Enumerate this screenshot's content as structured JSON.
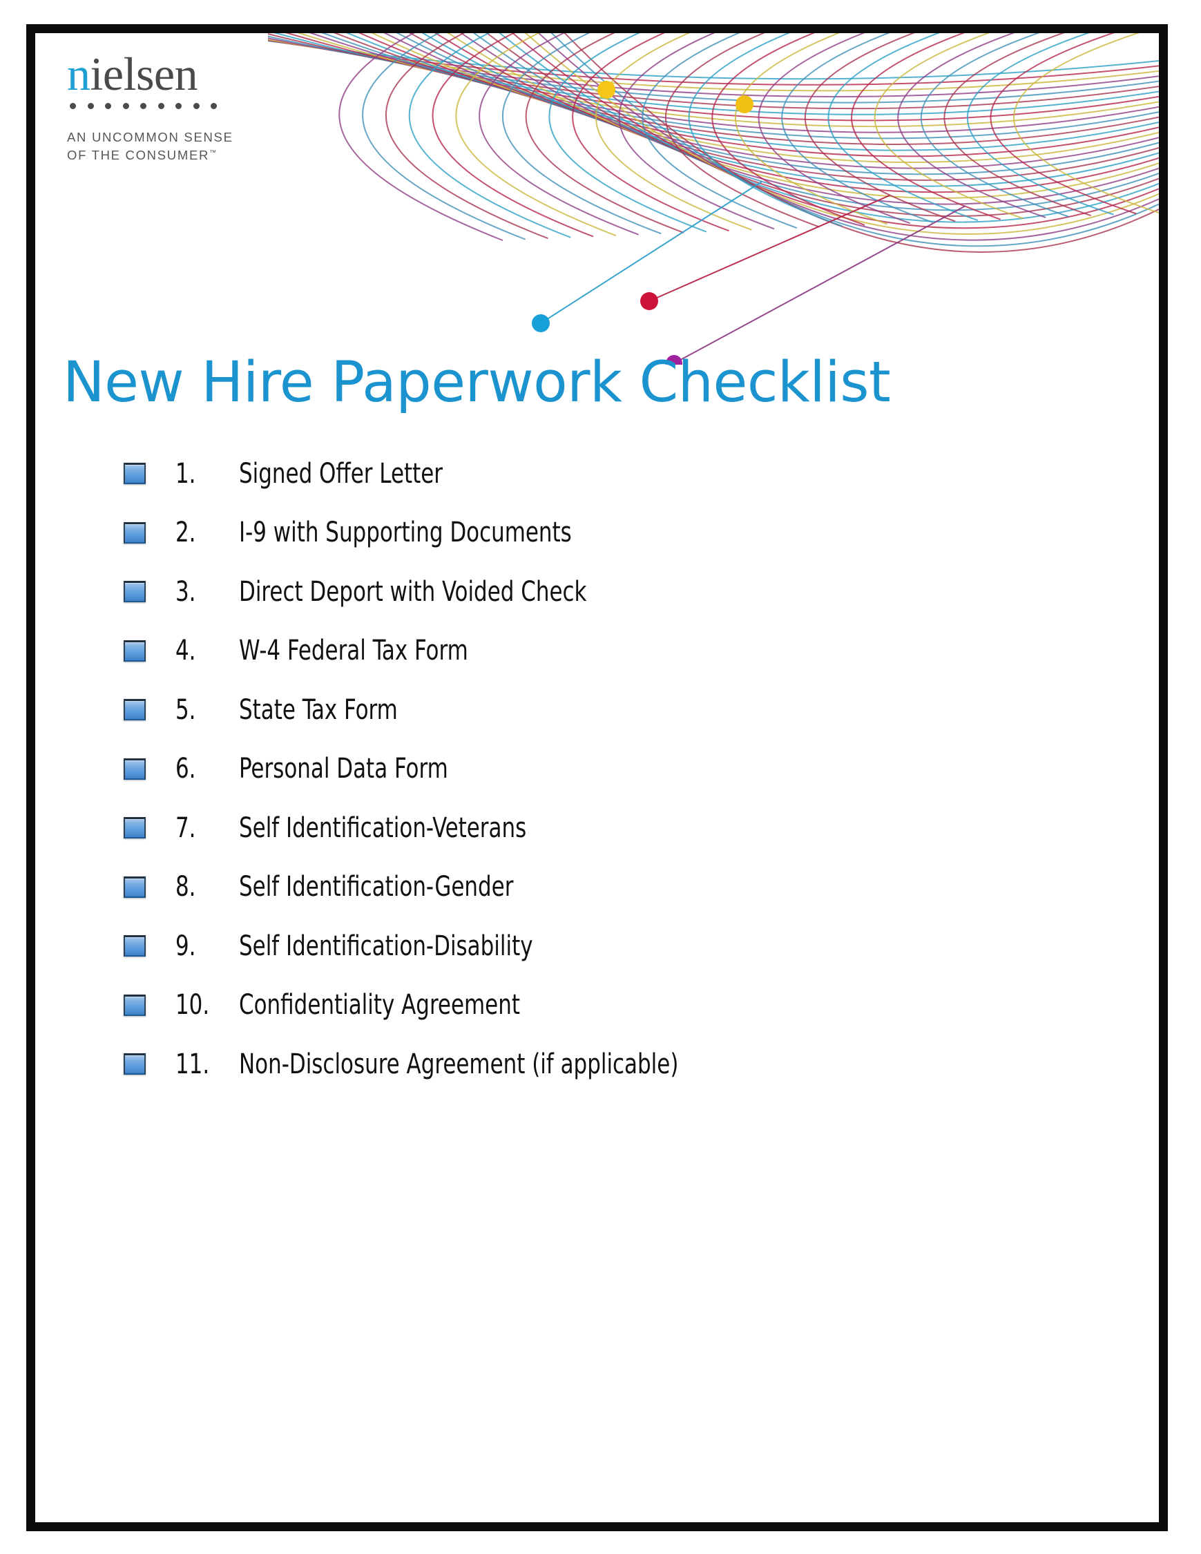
{
  "document": {
    "title": "New Hire Paperwork Checklist",
    "title_color": "#1b93cf"
  },
  "logo": {
    "wordmark_accent": "n",
    "wordmark_rest": "ielsen",
    "accent_color": "#1f9fd4",
    "word_color": "#4a4a4c",
    "dot_count": 9,
    "tagline_line1": "AN UNCOMMON SENSE",
    "tagline_line2": "OF THE CONSUMER",
    "tagline_trademark": "™"
  },
  "artwork": {
    "name": "nielsen-mesh-graphic",
    "line_colors": [
      "#2a9fc4",
      "#b5254a",
      "#c9b63c",
      "#8e3d86",
      "#3f8fb8",
      "#a8344f"
    ],
    "nodes": [
      {
        "name": "node-yellow-left",
        "color": "#f5c518"
      },
      {
        "name": "node-yellow-right",
        "color": "#f2bf14"
      },
      {
        "name": "node-cyan",
        "color": "#17a0d8"
      },
      {
        "name": "node-crimson",
        "color": "#cc1339"
      },
      {
        "name": "node-purple",
        "color": "#a0239e"
      }
    ]
  },
  "checklist": {
    "items": [
      {
        "number": "1.",
        "label": "Signed Offer Letter"
      },
      {
        "number": "2.",
        "label": "I-9 with Supporting Documents"
      },
      {
        "number": "3.",
        "label": "Direct Deport with Voided Check"
      },
      {
        "number": "4.",
        "label": "W-4 Federal Tax Form"
      },
      {
        "number": "5.",
        "label": "State Tax Form"
      },
      {
        "number": "6.",
        "label": "Personal Data Form"
      },
      {
        "number": "7.",
        "label": "Self Identification-Veterans"
      },
      {
        "number": "8.",
        "label": "Self Identification-Gender"
      },
      {
        "number": "9.",
        "label": "Self Identification-Disability"
      },
      {
        "number": "10.",
        "label": "Confidentiality Agreement"
      },
      {
        "number": "11.",
        "label": "Non-Disclosure Agreement (if applicable)"
      }
    ]
  }
}
